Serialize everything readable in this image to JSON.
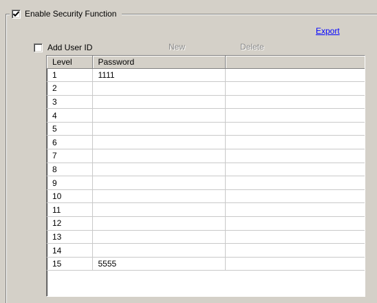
{
  "security": {
    "enable_label": "Enable Security Function",
    "enable_checked": true
  },
  "export_link": "Export",
  "add_user": {
    "label": "Add User ID",
    "checked": false
  },
  "buttons": {
    "new_label": "New",
    "delete_label": "Delete"
  },
  "table": {
    "columns": [
      "Level",
      "Password",
      ""
    ],
    "rows": [
      {
        "level": "1",
        "password": "1111"
      },
      {
        "level": "2",
        "password": ""
      },
      {
        "level": "3",
        "password": ""
      },
      {
        "level": "4",
        "password": ""
      },
      {
        "level": "5",
        "password": ""
      },
      {
        "level": "6",
        "password": ""
      },
      {
        "level": "7",
        "password": ""
      },
      {
        "level": "8",
        "password": ""
      },
      {
        "level": "9",
        "password": ""
      },
      {
        "level": "10",
        "password": ""
      },
      {
        "level": "11",
        "password": ""
      },
      {
        "level": "12",
        "password": ""
      },
      {
        "level": "13",
        "password": ""
      },
      {
        "level": "14",
        "password": ""
      },
      {
        "level": "15",
        "password": "5555"
      }
    ]
  },
  "colors": {
    "background": "#d4d0c8",
    "link": "#0000ff",
    "disabled_text": "#8a8a8a",
    "grid_line": "#c8c8c8"
  },
  "icons": {
    "checked_box": "checkbox-checked-icon",
    "unchecked_box": "checkbox-unchecked-icon"
  }
}
